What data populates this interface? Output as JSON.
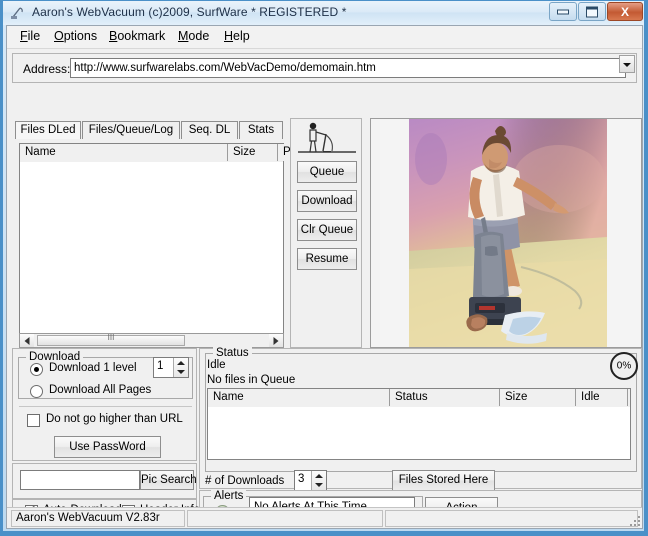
{
  "window": {
    "title": "Aaron's WebVacuum  (c)2009, SurfWare * REGISTERED *",
    "icon": "vacuum-app-icon",
    "minimize_label": "Minimize",
    "maximize_label": "Maximize",
    "close_label": "X"
  },
  "menu": [
    {
      "label": "File",
      "accel": "F"
    },
    {
      "label": "Options",
      "accel": "O"
    },
    {
      "label": "Bookmark",
      "accel": "B"
    },
    {
      "label": "Mode",
      "accel": "M"
    },
    {
      "label": "Help",
      "accel": "H"
    }
  ],
  "address": {
    "label": "Address:",
    "value": "http://www.surfwarelabs.com/WebVacDemo/demomain.htm",
    "placeholder": "",
    "dropdown_icon": "chevron-down-icon"
  },
  "tabs": [
    {
      "label": "Files DLed",
      "active": true
    },
    {
      "label": "Files/Queue/Log",
      "active": false
    },
    {
      "label": "Seq. DL",
      "active": false
    },
    {
      "label": "Stats",
      "active": false
    }
  ],
  "files_list": {
    "columns": [
      "Name",
      "Size",
      "Pa"
    ],
    "rows": []
  },
  "actions": {
    "icon": "vacuum-cleaning-person-icon",
    "buttons": [
      "Queue",
      "Download",
      "Clr Queue",
      "Resume"
    ]
  },
  "preview": {
    "alt": "woman-vacuuming-photo",
    "colors": {
      "sky_top": "#b98ac4",
      "sky_mid": "#d49bb4",
      "floor": "#e8d79a",
      "floor_right": "#d9c9a0",
      "skin": "#c08a63",
      "shirt": "#f2ece4",
      "shorts": "#8f93a6",
      "vacuum_body": "#7c8391",
      "vacuum_base": "#3d4350",
      "hair": "#6b4a33"
    }
  },
  "download_panel": {
    "group_title": "Download",
    "options": [
      {
        "label": "Download 1 level",
        "selected": true
      },
      {
        "label": "Download All Pages",
        "selected": false
      }
    ],
    "level_value": "1",
    "no_higher_label": "Do not go higher than URL",
    "no_higher_checked": false,
    "password_button": "Use PassWord"
  },
  "pic_search": {
    "input_value": "",
    "placeholder": "",
    "button_label": "Pic Search"
  },
  "auto_row": {
    "auto_download_label": "Auto-Download",
    "auto_download_checked": true,
    "header_info_label": "Header Info",
    "header_info_checked": false
  },
  "status": {
    "group_title": "Status",
    "state": "Idle",
    "queue_message": "No files in Queue",
    "progress": "0%"
  },
  "queue_list": {
    "columns": [
      "Name",
      "Status",
      "Size",
      "Idle"
    ],
    "rows": []
  },
  "downloads": {
    "label": "# of Downloads",
    "value": "3",
    "files_stored_button": "Files Stored Here"
  },
  "alerts": {
    "group_title": "Alerts",
    "led": "alert-status-led",
    "message": "No Alerts At This Time",
    "action_button": "Action"
  },
  "statusbar": {
    "pane1": "Aaron's WebVacuum V2.83r",
    "pane2": "",
    "pane3": ""
  }
}
